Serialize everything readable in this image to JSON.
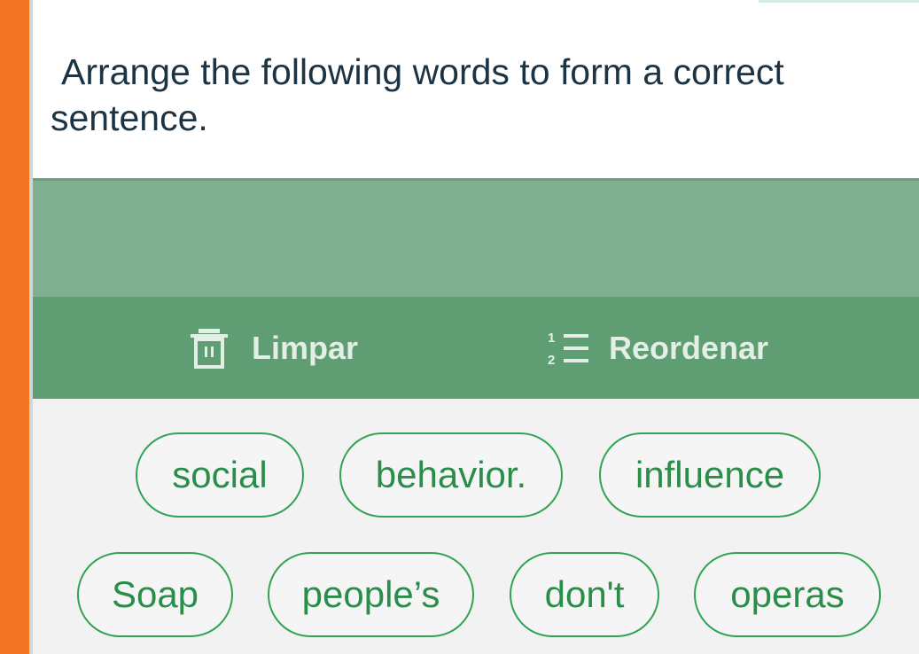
{
  "question": {
    "text": "Arrange the following words to form a correct sentence."
  },
  "toolbar": {
    "clear_label": "Limpar",
    "reorder_label": "Reordenar",
    "reorder_icon_digits": [
      "1",
      "2"
    ]
  },
  "word_bank": {
    "words": [
      "social",
      "behavior.",
      "influence",
      "Soap",
      "people’s",
      "don't",
      "operas"
    ]
  },
  "colors": {
    "accent_orange": "#f27323",
    "answer_area": "#80b08f",
    "toolbar": "#5f9e73",
    "chip_border": "#31a354",
    "chip_text": "#2a8d4a",
    "question_text": "#1c3344"
  },
  "icons": {
    "clear": "trash-icon",
    "reorder": "numbered-list-icon"
  }
}
